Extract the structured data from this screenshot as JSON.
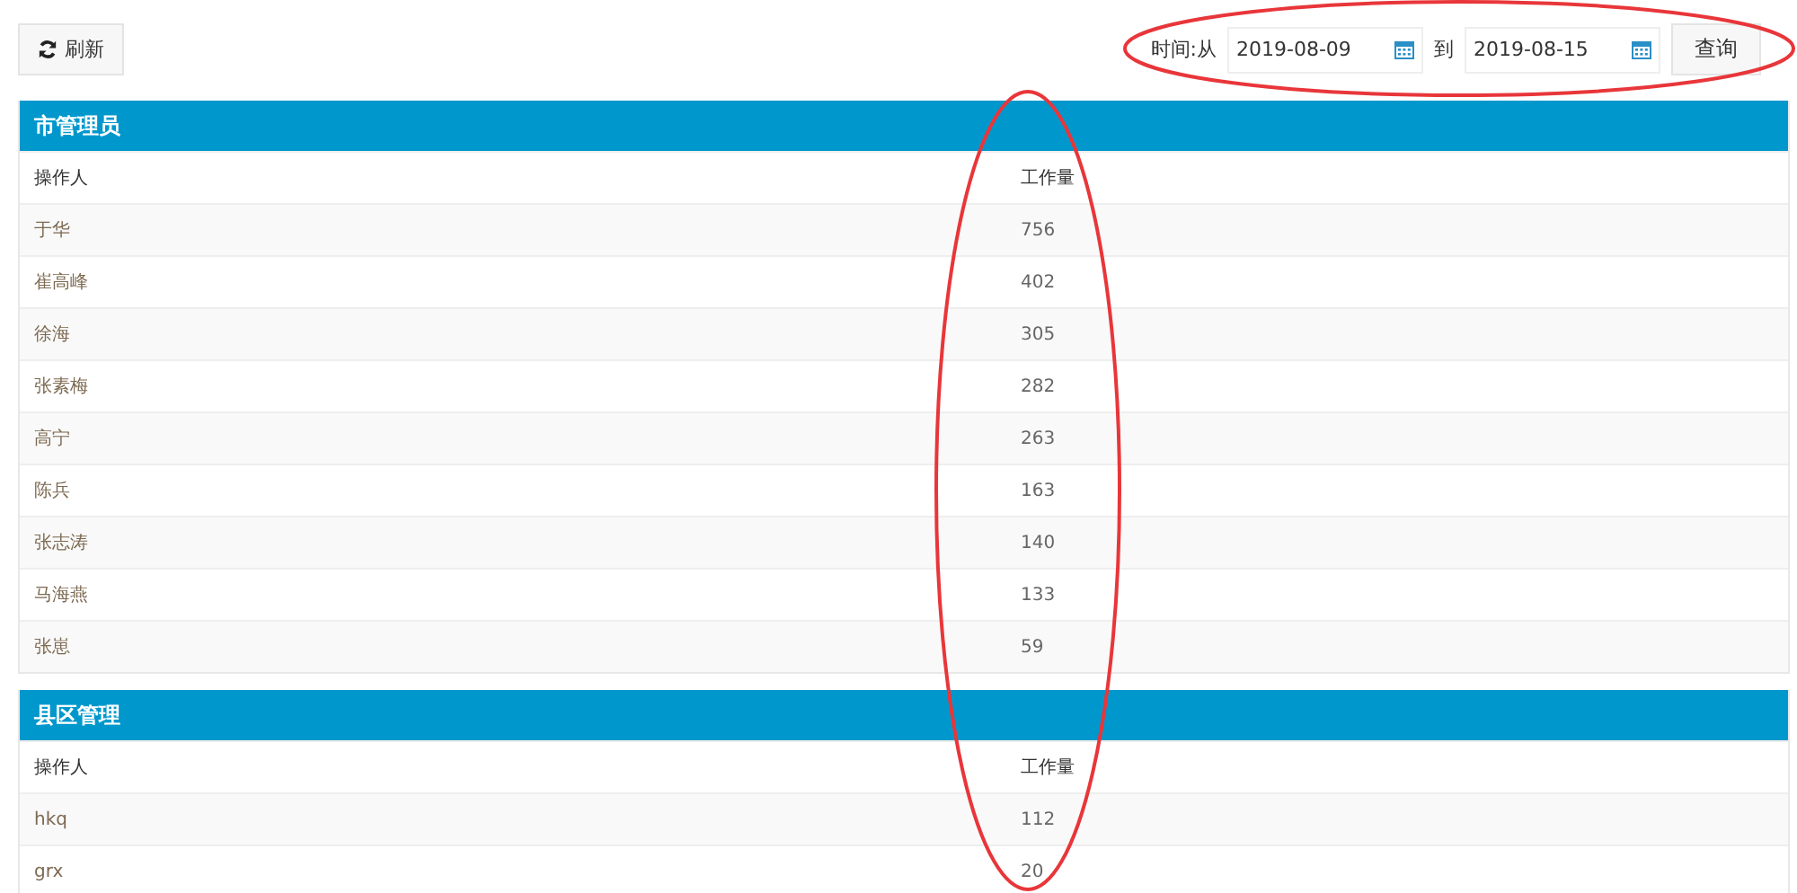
{
  "toolbar": {
    "refresh_button": "刷新",
    "date_filter": {
      "label": "时间:从",
      "from": "2019-08-09",
      "separator": "到",
      "to": "2019-08-15"
    },
    "query_button": "查询"
  },
  "panels": [
    {
      "title": "市管理员",
      "columns": [
        "操作人",
        "工作量"
      ],
      "rows": [
        {
          "name": "于华",
          "count": "756"
        },
        {
          "name": "崔高峰",
          "count": "402"
        },
        {
          "name": "徐海",
          "count": "305"
        },
        {
          "name": "张素梅",
          "count": "282"
        },
        {
          "name": "高宁",
          "count": "263"
        },
        {
          "name": "陈兵",
          "count": "163"
        },
        {
          "name": "张志涛",
          "count": "140"
        },
        {
          "name": "马海燕",
          "count": "133"
        },
        {
          "name": "张崽",
          "count": "59"
        }
      ]
    },
    {
      "title": "县区管理",
      "columns": [
        "操作人",
        "工作量"
      ],
      "rows": [
        {
          "name": "hkq",
          "count": "112"
        },
        {
          "name": "grx",
          "count": "20"
        }
      ]
    }
  ],
  "annotations": [
    {
      "kind": "ellipse",
      "color": "#e8363a"
    },
    {
      "kind": "ellipse",
      "color": "#e8363a"
    }
  ]
}
